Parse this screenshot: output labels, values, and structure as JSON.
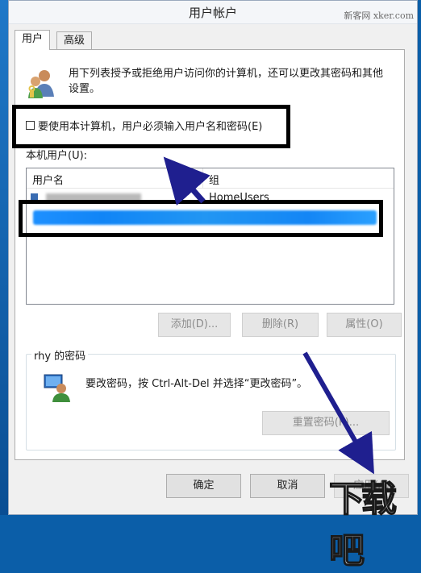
{
  "window": {
    "title": "用户帐户",
    "watermark": "新客网 xker.com",
    "close_icon": "close-icon"
  },
  "tabs": [
    {
      "label": "用户",
      "selected": true
    },
    {
      "label": "高级",
      "selected": false
    }
  ],
  "intro": {
    "icon": "users-icon",
    "text": "用下列表授予或拒绝用户访问你的计算机，还可以更改其密码和其他设置。"
  },
  "require_password": {
    "label": "要使用本计算机，用户必须输入用户名和密码(E)",
    "checked": false
  },
  "users_list": {
    "label": "本机用户(U):",
    "columns": [
      "用户名",
      "组"
    ],
    "rows": [
      {
        "name": "",
        "group": "HomeUsers",
        "selected": false
      },
      {
        "name": "",
        "group": "",
        "selected": true
      }
    ]
  },
  "list_buttons": {
    "add": "添加(D)...",
    "remove": "删除(R)",
    "properties": "属性(O)"
  },
  "password_group": {
    "title": "rhy 的密码",
    "icon": "computer-user-icon",
    "text": "要改密码，按 Ctrl-Alt-Del 并选择“更改密码”。",
    "reset_button": "重置密码(P)..."
  },
  "dialog_buttons": {
    "ok": "确定",
    "cancel": "取消",
    "apply": "应用(A)"
  },
  "corner_watermark": "下载吧",
  "colors": {
    "annotation_arrow": "#1f1f8f",
    "highlight_box": "#000000",
    "selection": "#1e90ff",
    "desktop": "#0b5ea8"
  }
}
